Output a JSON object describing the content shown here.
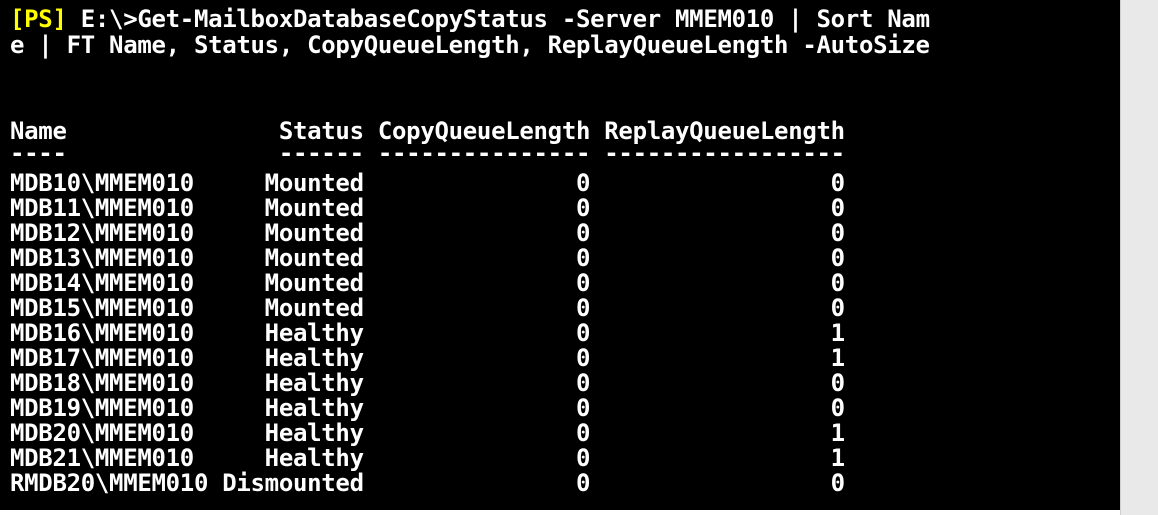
{
  "console": {
    "prompt_tag": "[PS]",
    "command_line_1": " E:\\>Get-MailboxDatabaseCopyStatus -Server MMEM010 | Sort Nam",
    "command_line_2": "e | FT Name, Status, CopyQueueLength, ReplayQueueLength -AutoSize",
    "header_line": "Name               Status CopyQueueLength ReplayQueueLength",
    "dash_line": "----               ------ --------------- -----------------",
    "rows": [
      "MDB10\\MMEM010     Mounted               0                 0",
      "MDB11\\MMEM010     Mounted               0                 0",
      "MDB12\\MMEM010     Mounted               0                 0",
      "MDB13\\MMEM010     Mounted               0                 0",
      "MDB14\\MMEM010     Mounted               0                 0",
      "MDB15\\MMEM010     Mounted               0                 0",
      "MDB16\\MMEM010     Healthy               0                 1",
      "MDB17\\MMEM010     Healthy               0                 1",
      "MDB18\\MMEM010     Healthy               0                 0",
      "MDB19\\MMEM010     Healthy               0                 0",
      "MDB20\\MMEM010     Healthy               0                 1",
      "MDB21\\MMEM010     Healthy               0                 1",
      "RMDB20\\MMEM010 Dismounted               0                 0"
    ]
  },
  "colors": {
    "background": "#000000",
    "text": "#ffffff",
    "prompt_tag": "#ffff00",
    "scrollbar": "#e9e9e9"
  }
}
